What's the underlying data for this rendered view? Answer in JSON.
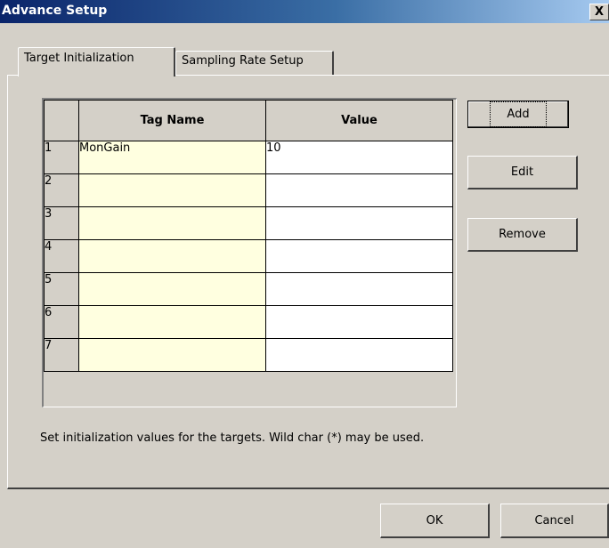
{
  "window": {
    "title": "Advance Setup",
    "close_label": "X"
  },
  "tabs": [
    {
      "label": "Target Initialization",
      "active": true
    },
    {
      "label": "Sampling Rate Setup",
      "active": false
    }
  ],
  "grid": {
    "headers": [
      "",
      "Tag Name",
      "Value"
    ],
    "rows": [
      {
        "num": "1",
        "tag": "MonGain",
        "value": "10"
      },
      {
        "num": "2",
        "tag": "",
        "value": ""
      },
      {
        "num": "3",
        "tag": "",
        "value": ""
      },
      {
        "num": "4",
        "tag": "",
        "value": ""
      },
      {
        "num": "5",
        "tag": "",
        "value": ""
      },
      {
        "num": "6",
        "tag": "",
        "value": ""
      },
      {
        "num": "7",
        "tag": "",
        "value": ""
      }
    ]
  },
  "side_buttons": {
    "add": "Add",
    "edit": "Edit",
    "remove": "Remove"
  },
  "hint": "Set initialization values for the targets. Wild char (*) may be used.",
  "footer_buttons": {
    "ok": "OK",
    "cancel": "Cancel"
  },
  "colors": {
    "title_bar_start": "#0a246a",
    "title_bar_end": "#a6caf0",
    "dialog_face": "#d4d0c8",
    "tag_cell": "#ffffe0"
  }
}
